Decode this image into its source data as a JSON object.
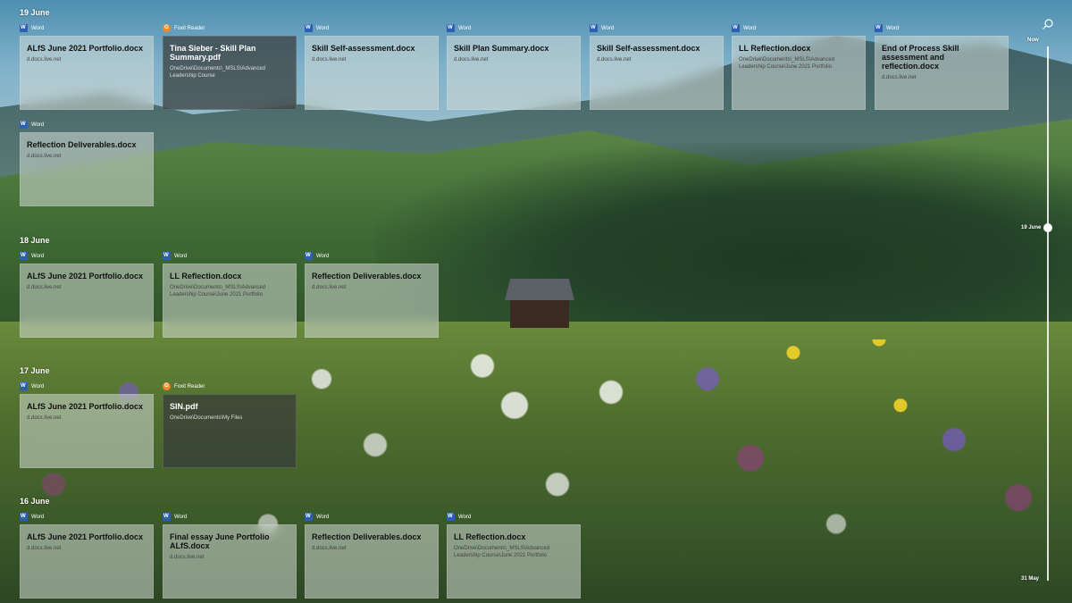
{
  "days": [
    {
      "label": "19 June"
    },
    {
      "label": "18 June"
    },
    {
      "label": "17 June"
    },
    {
      "label": "16 June"
    }
  ],
  "cards": [
    {
      "app": "Word",
      "title": "ALfS June 2021 Portfolio.docx",
      "sub": "d.docs.live.net"
    },
    {
      "app": "Foxit Reader",
      "title": "Tina Sieber - Skill Plan Summary.pdf",
      "sub": "OneDrive\\Documents\\_MSLS\\Advanced Leadership Course"
    },
    {
      "app": "Word",
      "title": "Skill Self-assessment.docx",
      "sub": "d.docs.live.net"
    },
    {
      "app": "Word",
      "title": "Skill Plan Summary.docx",
      "sub": "d.docs.live.net"
    },
    {
      "app": "Word",
      "title": "Skill Self-assessment.docx",
      "sub": "d.docs.live.net"
    },
    {
      "app": "Word",
      "title": "LL Reflection.docx",
      "sub": "OneDrive\\Documents\\_MSLS\\Advanced Leadership Course\\June 2021 Portfolio"
    },
    {
      "app": "Word",
      "title": "End of Process Skill assessment and reflection.docx",
      "sub": "d.docs.live.net"
    },
    {
      "app": "Word",
      "title": "Reflection Deliverables.docx",
      "sub": "d.docs.live.net"
    },
    {
      "app": "Word",
      "title": "ALfS June 2021 Portfolio.docx",
      "sub": "d.docs.live.net"
    },
    {
      "app": "Word",
      "title": "LL Reflection.docx",
      "sub": "OneDrive\\Documents\\_MSLS\\Advanced Leadership Course\\June 2021 Portfolio"
    },
    {
      "app": "Word",
      "title": "Reflection Deliverables.docx",
      "sub": "d.docs.live.net"
    },
    {
      "app": "Word",
      "title": "ALfS June 2021 Portfolio.docx",
      "sub": "d.docs.live.net"
    },
    {
      "app": "Foxit Reader",
      "title": "SIN.pdf",
      "sub": "OneDrive\\Documents\\My Files"
    },
    {
      "app": "Word",
      "title": "ALfS June 2021 Portfolio.docx",
      "sub": "d.docs.live.net"
    },
    {
      "app": "Word",
      "title": "Final essay June Portfolio ALfS.docx",
      "sub": "d.docs.live.net"
    },
    {
      "app": "Word",
      "title": "Reflection Deliverables.docx",
      "sub": "d.docs.live.net"
    },
    {
      "app": "Word",
      "title": "LL Reflection.docx",
      "sub": "OneDrive\\Documents\\_MSLS\\Advanced Leadership Course\\June 2021 Portfolio"
    }
  ],
  "scrubber": {
    "top_label": "Now",
    "mid_label": "19 June",
    "bottom_label": "31 May"
  },
  "icons": {
    "word": "word-app-icon",
    "foxit": "foxit-reader-app-icon",
    "search": "search-icon"
  },
  "colors": {
    "word": "#2b5fb4",
    "foxit": "#f08a24"
  }
}
